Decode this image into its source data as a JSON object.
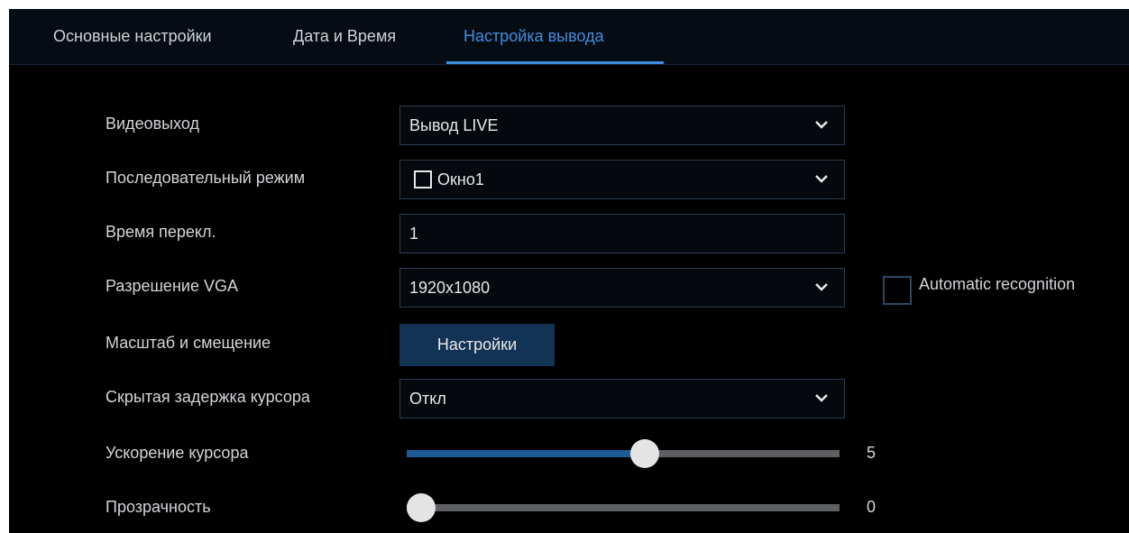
{
  "tabs": [
    {
      "label": "Основные настройки",
      "active": false
    },
    {
      "label": "Дата и Время",
      "active": false
    },
    {
      "label": "Настройка вывода",
      "active": true
    }
  ],
  "settings": {
    "video_output": {
      "label": "Видеовыход",
      "value": "Вывод LIVE"
    },
    "sequence_mode": {
      "label": "Последовательный режим",
      "value": "Окно1",
      "checked": false
    },
    "switch_time": {
      "label": "Время перекл.",
      "value": "1"
    },
    "vga_resolution": {
      "label": "Разрешение VGA",
      "value": "1920x1080",
      "auto_label": "Automatic recognition",
      "auto_checked": false
    },
    "scale_offset": {
      "label": "Масштаб и смещение",
      "button_label": "Настройки"
    },
    "cursor_hide_delay": {
      "label": "Скрытая задержка курсора",
      "value": "Откл"
    },
    "cursor_acceleration": {
      "label": "Ускорение курсора",
      "value": "5",
      "fraction": 0.55
    },
    "transparency": {
      "label": "Прозрачность",
      "value": "0",
      "fraction": 0.0
    }
  },
  "colors": {
    "accent": "#3f8ee0",
    "button_bg": "#123354",
    "slider_fill": "#1e5a95"
  },
  "icons": {
    "dropdown": "chevron-down-icon",
    "checkbox": "checkbox-icon"
  }
}
